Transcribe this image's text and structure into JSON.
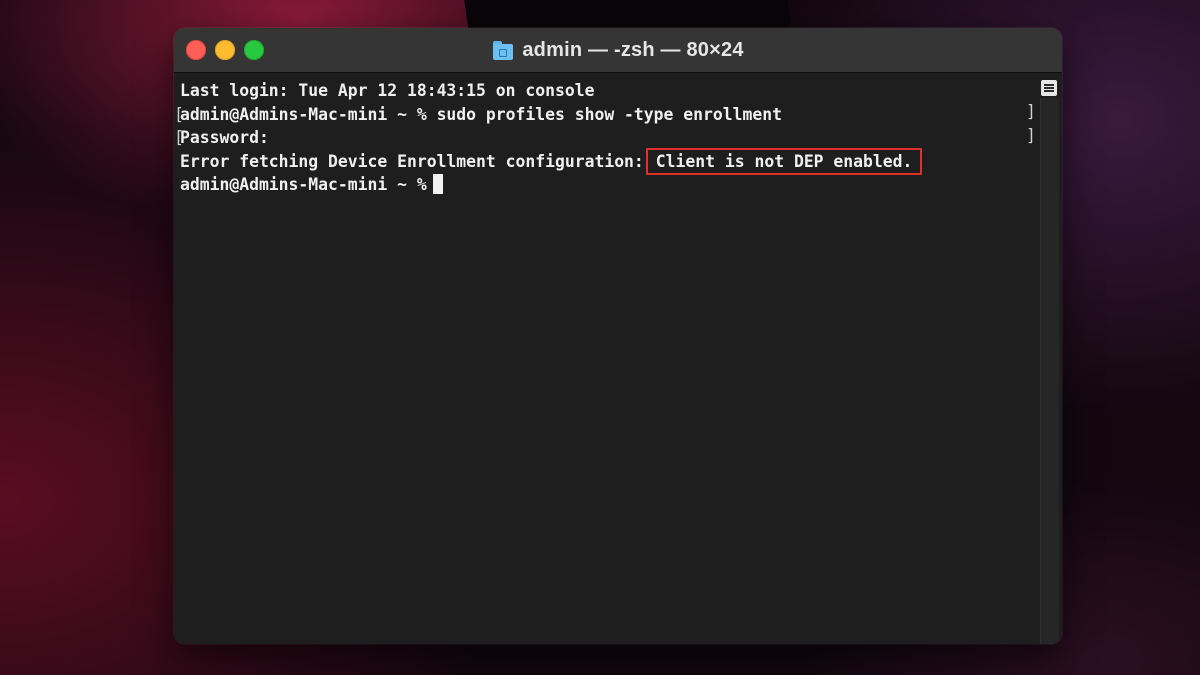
{
  "window": {
    "title": "admin — -zsh — 80×24"
  },
  "terminal": {
    "lines": [
      "Last login: Tue Apr 12 18:43:15 on console",
      "admin@Admins-Mac-mini ~ % sudo profiles show -type enrollment",
      "Password:",
      "Error fetching Device Enrollment configuration:",
      "admin@Admins-Mac-mini ~ %"
    ],
    "highlighted_error": "Client is not DEP enabled."
  },
  "colors": {
    "highlight_border": "#e0322d",
    "terminal_bg": "#1e1e1e",
    "terminal_fg": "#f0f0f0"
  }
}
